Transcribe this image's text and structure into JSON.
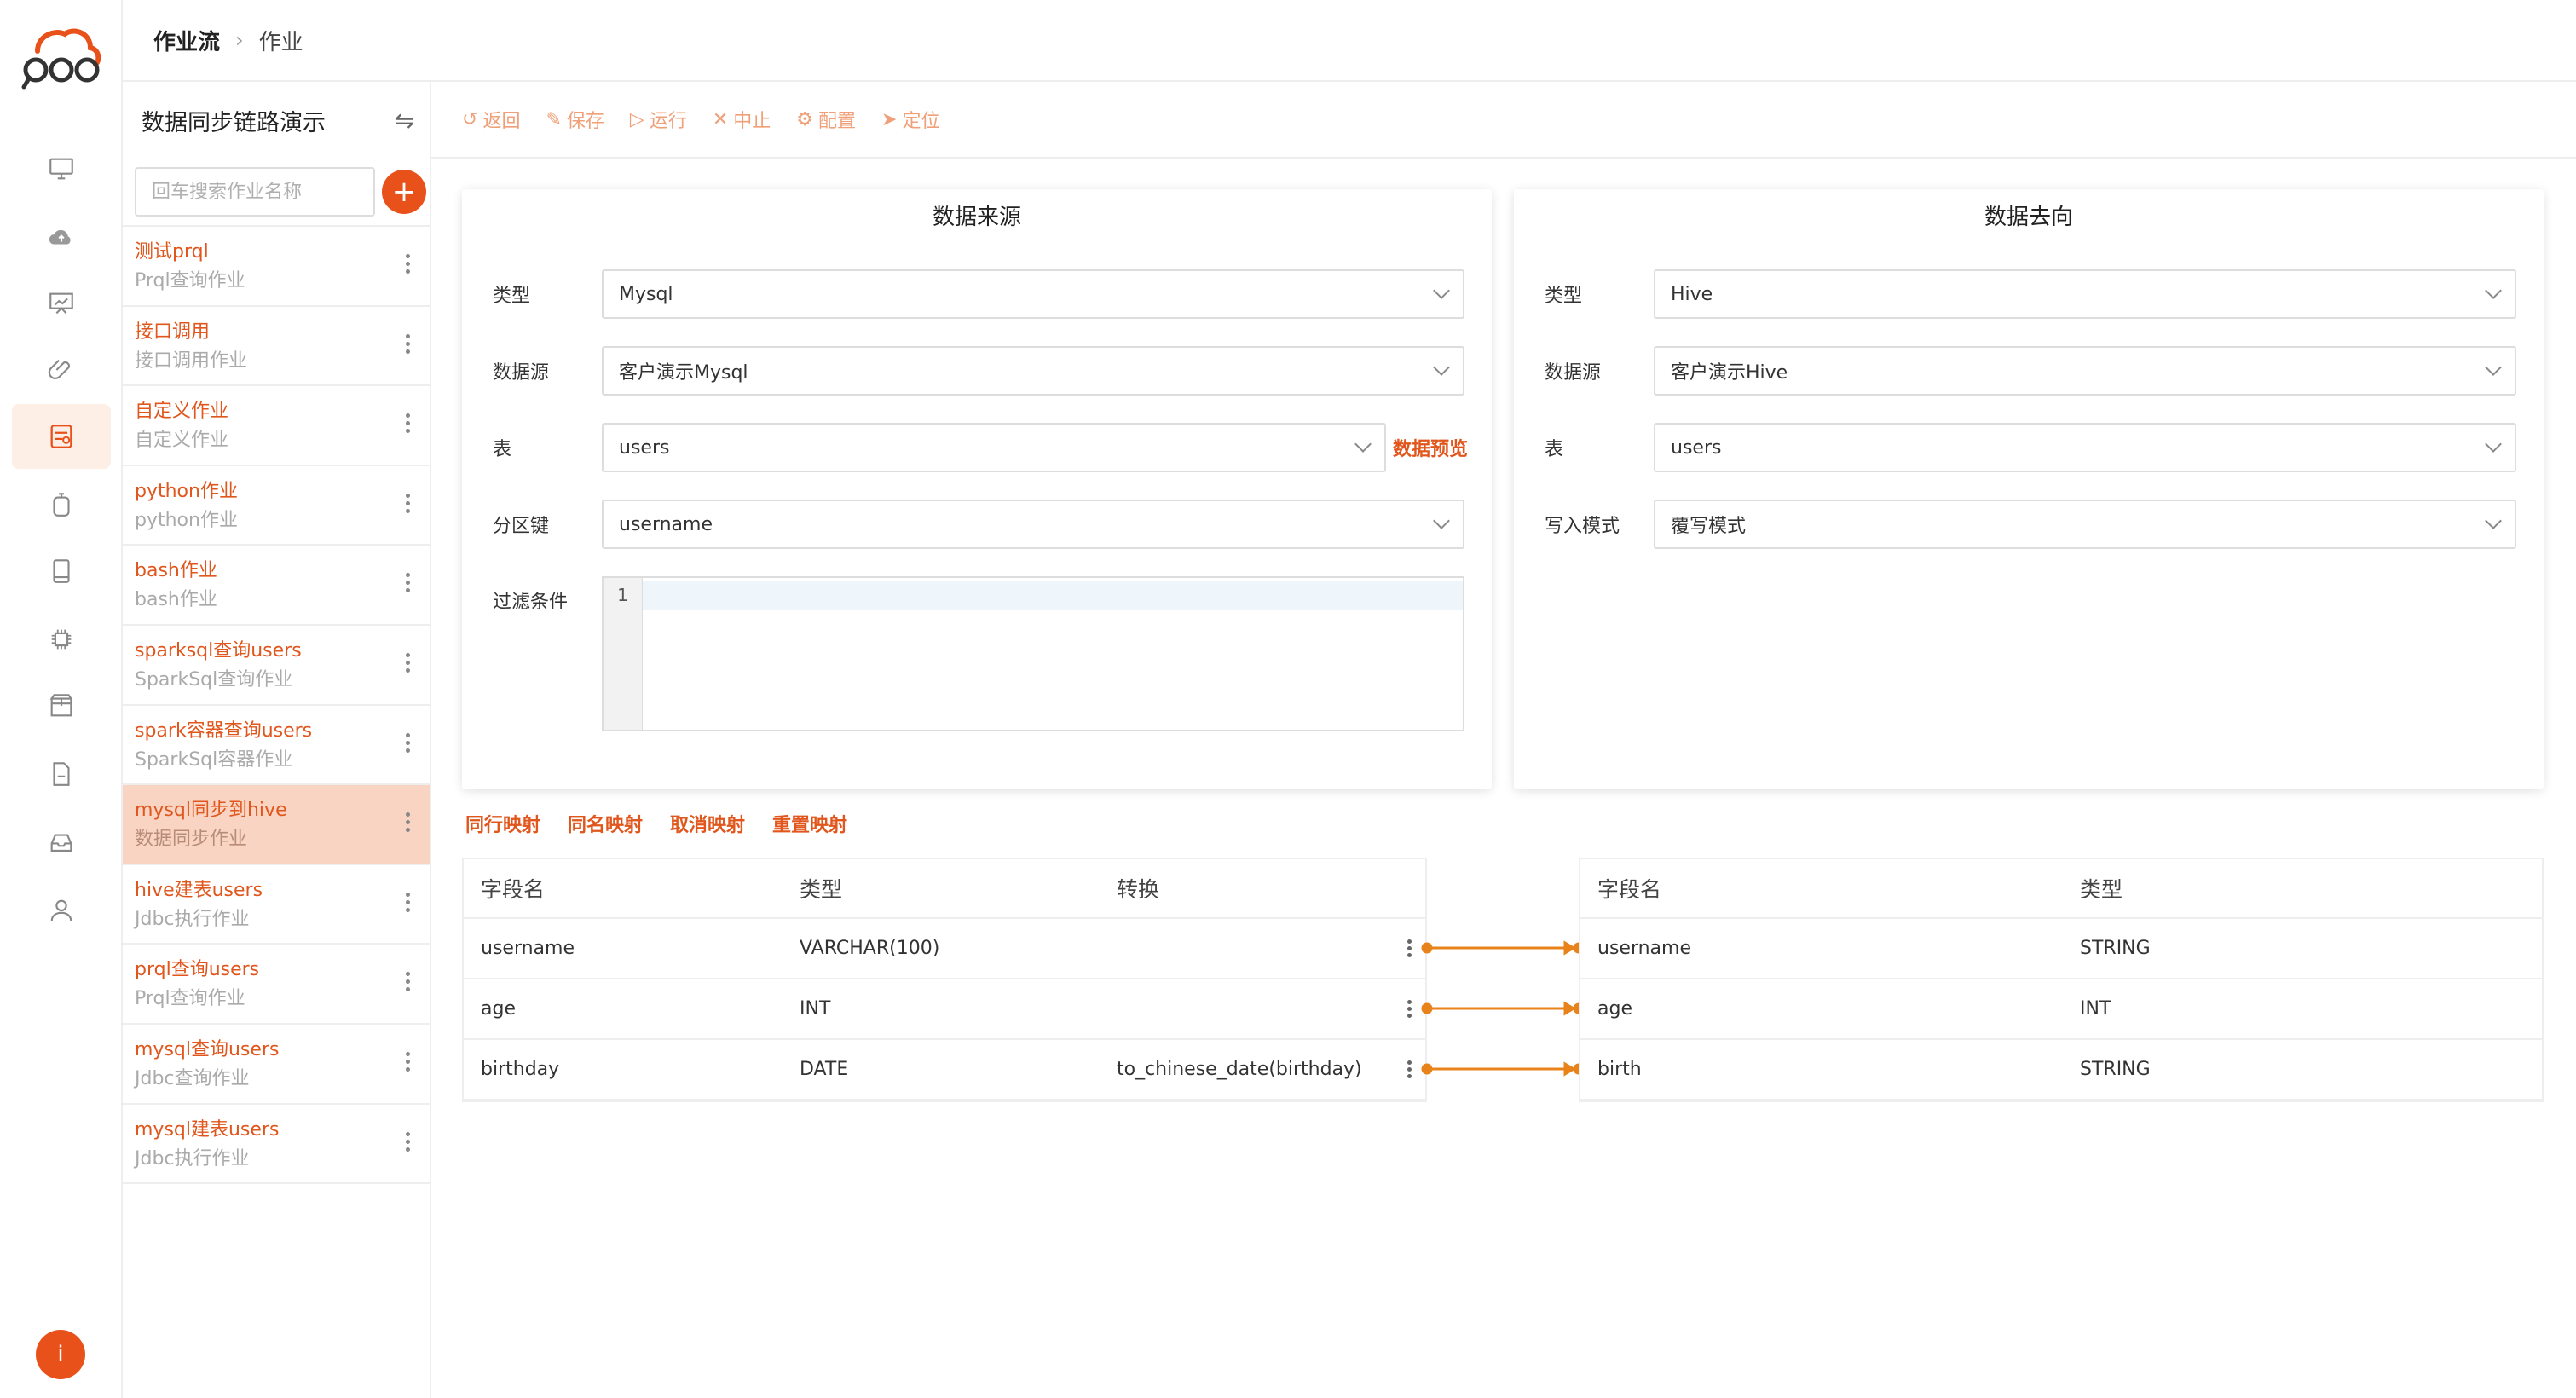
{
  "app": {
    "logo": "logo-icon"
  },
  "rail": {
    "items": [
      "monitor-icon",
      "cloud-upload-icon",
      "presentation-icon",
      "paperclip-icon",
      "workflow-icon",
      "timer-icon",
      "tablet-icon",
      "chip-icon",
      "package-icon",
      "file-icon",
      "inbox-icon",
      "user-icon"
    ],
    "active_index": 4,
    "info_label": "i"
  },
  "breadcrumb": {
    "root": "作业流",
    "current": "作业"
  },
  "sidebar": {
    "title": "数据同步链路演示",
    "search_placeholder": "回车搜索作业名称",
    "add_label": "+",
    "jobs": [
      {
        "name": "测试prql",
        "desc": "Prql查询作业"
      },
      {
        "name": "接口调用",
        "desc": "接口调用作业"
      },
      {
        "name": "自定义作业",
        "desc": "自定义作业"
      },
      {
        "name": "python作业",
        "desc": "python作业"
      },
      {
        "name": "bash作业",
        "desc": "bash作业"
      },
      {
        "name": "sparksql查询users",
        "desc": "SparkSql查询作业"
      },
      {
        "name": "spark容器查询users",
        "desc": "SparkSql容器作业"
      },
      {
        "name": "mysql同步到hive",
        "desc": "数据同步作业"
      },
      {
        "name": "hive建表users",
        "desc": "Jdbc执行作业"
      },
      {
        "name": "prql查询users",
        "desc": "Prql查询作业"
      },
      {
        "name": "mysql查询users",
        "desc": "Jdbc查询作业"
      },
      {
        "name": "mysql建表users",
        "desc": "Jdbc执行作业"
      }
    ],
    "active_index": 7
  },
  "toolbar": {
    "back": "返回",
    "save": "保存",
    "run": "运行",
    "stop": "中止",
    "config": "配置",
    "locate": "定位"
  },
  "source": {
    "title": "数据来源",
    "type_label": "类型",
    "type_value": "Mysql",
    "ds_label": "数据源",
    "ds_value": "客户演示Mysql",
    "table_label": "表",
    "table_value": "users",
    "preview": "数据预览",
    "partition_label": "分区键",
    "partition_value": "username",
    "filter_label": "过滤条件",
    "line_no": "1"
  },
  "target": {
    "title": "数据去向",
    "type_label": "类型",
    "type_value": "Hive",
    "ds_label": "数据源",
    "ds_value": "客户演示Hive",
    "table_label": "表",
    "table_value": "users",
    "mode_label": "写入模式",
    "mode_value": "覆写模式"
  },
  "mapping_actions": {
    "row": "同行映射",
    "name": "同名映射",
    "cancel": "取消映射",
    "reset": "重置映射"
  },
  "source_table": {
    "headers": {
      "field": "字段名",
      "type": "类型",
      "transform": "转换"
    },
    "rows": [
      {
        "field": "username",
        "type": "VARCHAR(100)",
        "transform": ""
      },
      {
        "field": "age",
        "type": "INT",
        "transform": ""
      },
      {
        "field": "birthday",
        "type": "DATE",
        "transform": "to_chinese_date(birthday)"
      }
    ]
  },
  "target_table": {
    "headers": {
      "field": "字段名",
      "type": "类型"
    },
    "rows": [
      {
        "field": "username",
        "type": "STRING"
      },
      {
        "field": "age",
        "type": "INT"
      },
      {
        "field": "birth",
        "type": "STRING"
      }
    ]
  },
  "colors": {
    "accent": "#e8521a",
    "link": "#e0561c",
    "active_row": "#f9d4c3"
  }
}
